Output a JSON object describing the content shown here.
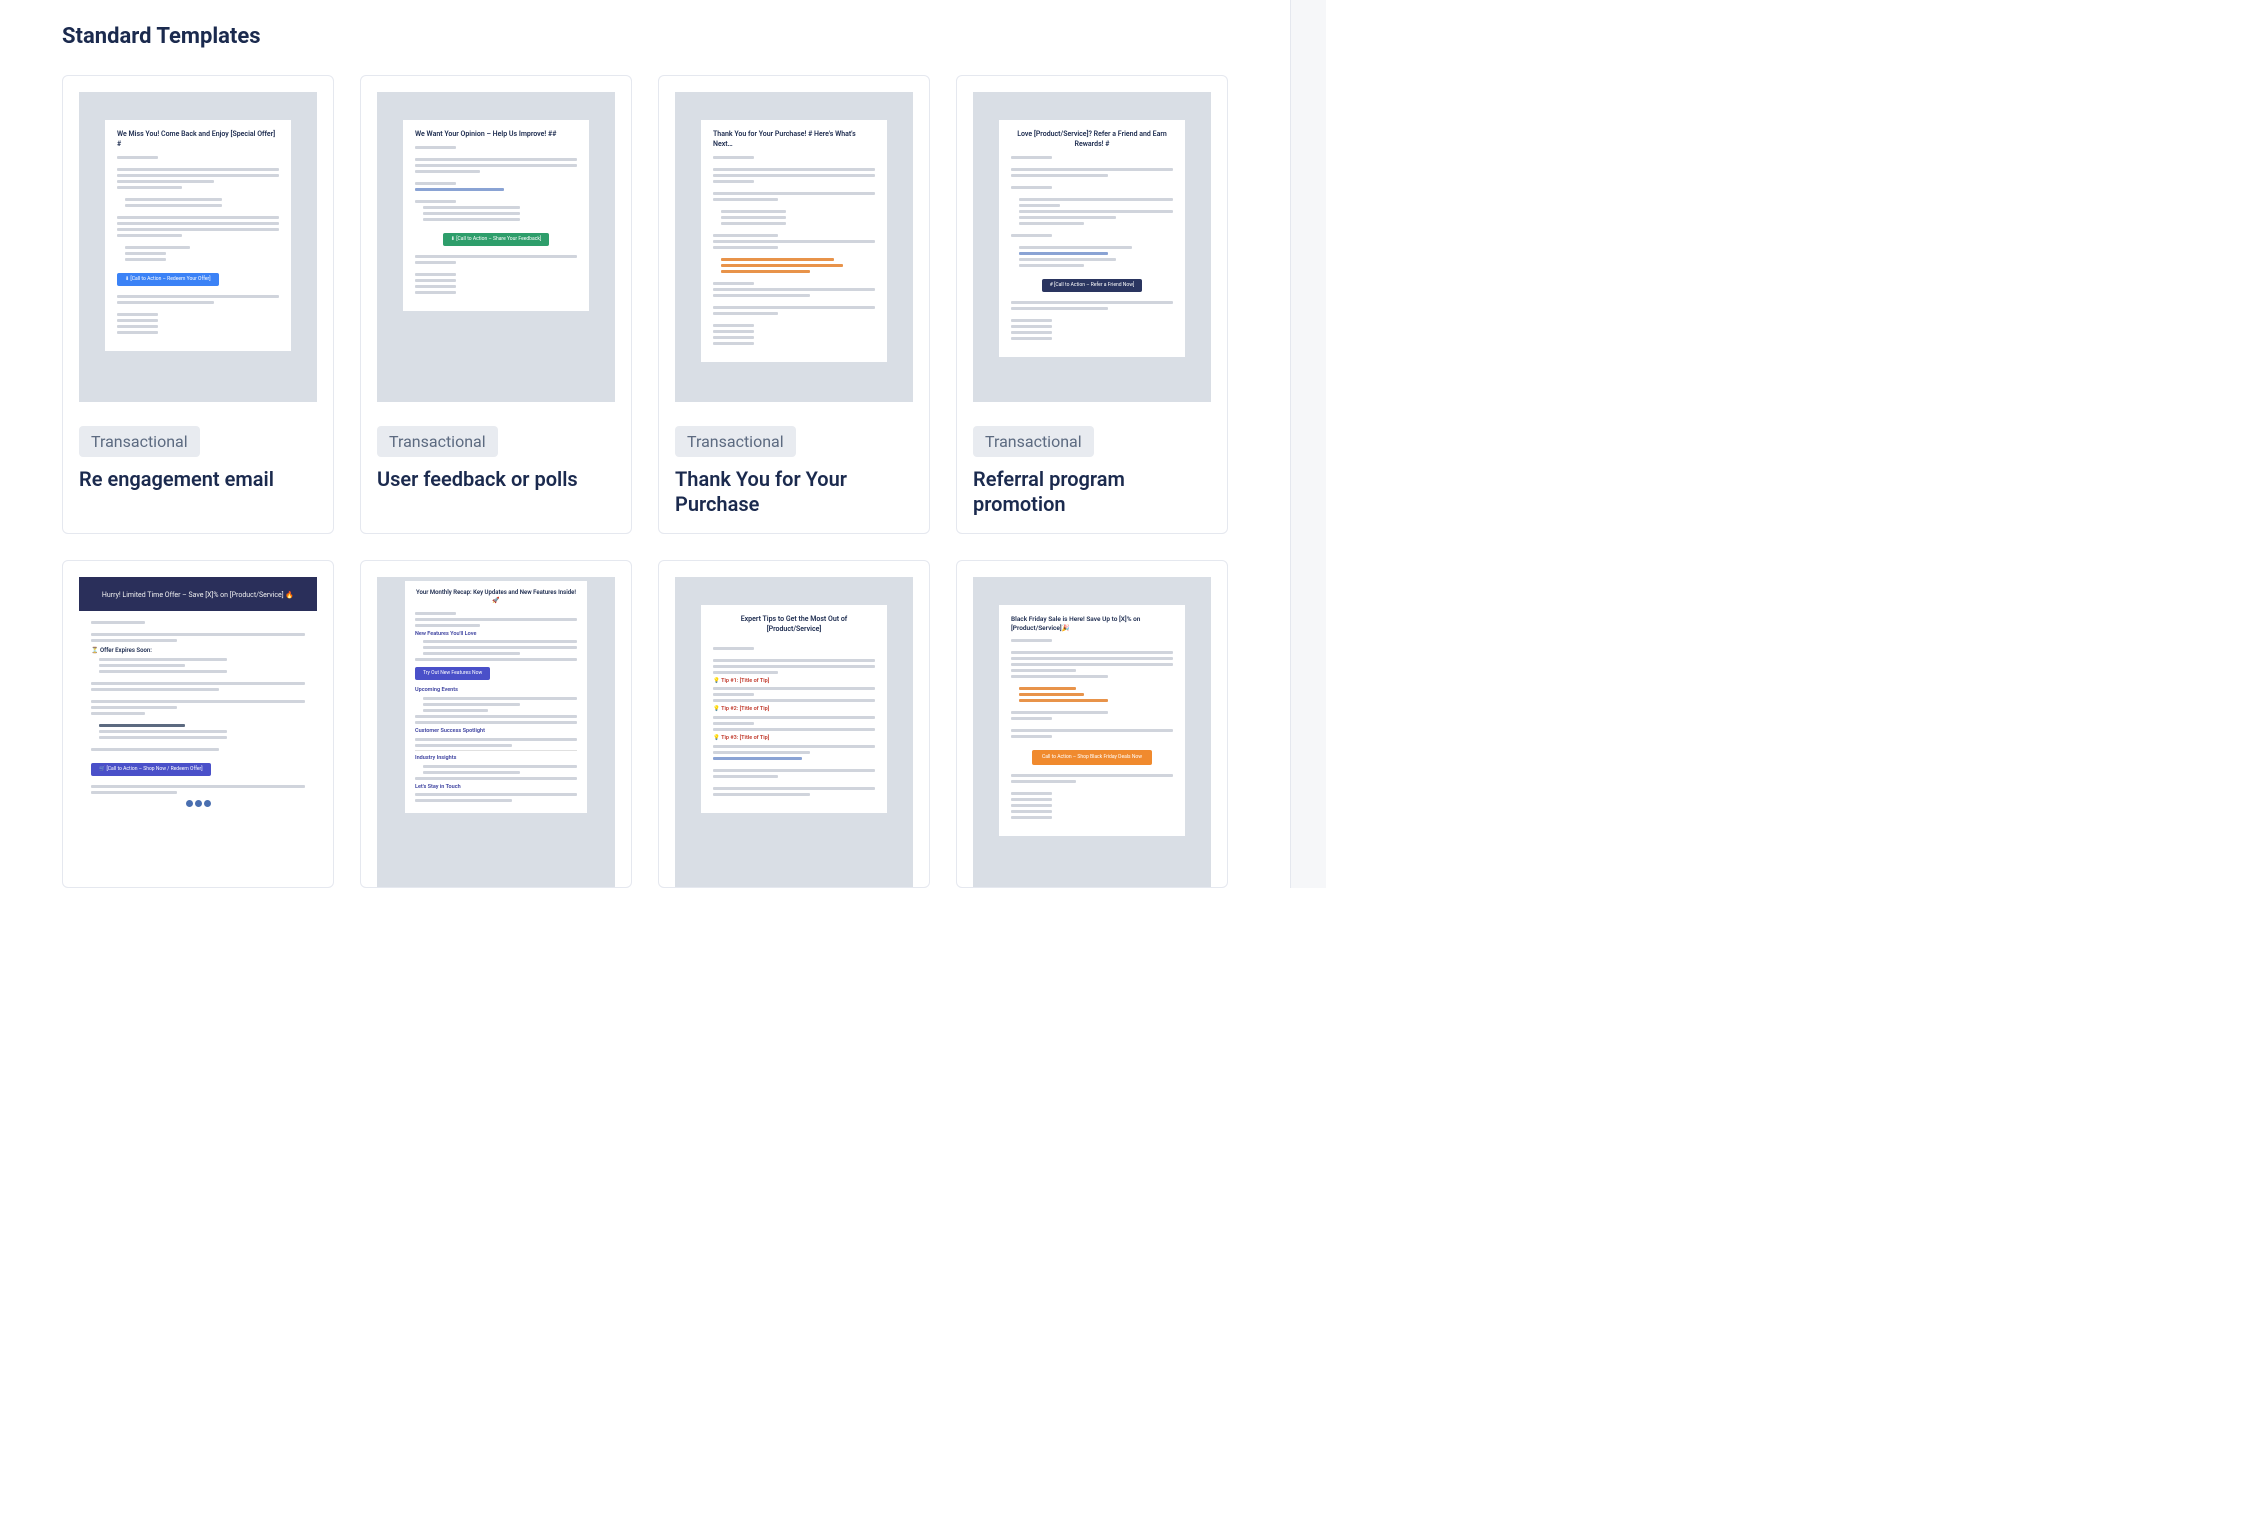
{
  "section_title": "Standard Templates",
  "badge": "Transactional",
  "templates": [
    {
      "title": "Re engagement email",
      "pv": {
        "head": "We Miss You! Come Back and Enjoy [Special Offer] #"
      }
    },
    {
      "title": "User feedback or polls",
      "pv": {
        "head": "We Want Your Opinion – Help Us Improve! ##"
      }
    },
    {
      "title": "Thank You for Your Purchase",
      "pv": {
        "head": "Thank You for Your Purchase! # Here's What's Next…"
      }
    },
    {
      "title": "Referral program promotion",
      "pv": {
        "head": "Love [Product/Service]? Refer a Friend and Earn Rewards! #"
      }
    }
  ],
  "row2": [
    {
      "pv": {
        "head": "Hurry! Limited Time Offer – Save [X]% on [Product/Service] 🔥",
        "sub": "⏳ Offer Expires Soon:"
      }
    },
    {
      "pv": {
        "head": "Your Monthly Recap: Key Updates and New Features Inside! 🚀",
        "s1": "New Features You'll Love",
        "s2": "Upcoming Events",
        "s3": "Customer Success Spotlight",
        "s4": "Industry Insights",
        "s5": "Let's Stay in Touch"
      }
    },
    {
      "pv": {
        "head": "Expert Tips to Get the Most Out of [Product/Service]",
        "t1": "💡 Tip #1: [Title of Tip]",
        "t2": "💡 Tip #2: [Title of Tip]",
        "t3": "💡 Tip #3: [Title of Tip]"
      }
    },
    {
      "pv": {
        "head": "Black Friday Sale is Here! Save Up to [X]% on [Product/Service]🎉",
        "btn": "Call to Action – Shop Black Friday Deals Now"
      }
    }
  ]
}
